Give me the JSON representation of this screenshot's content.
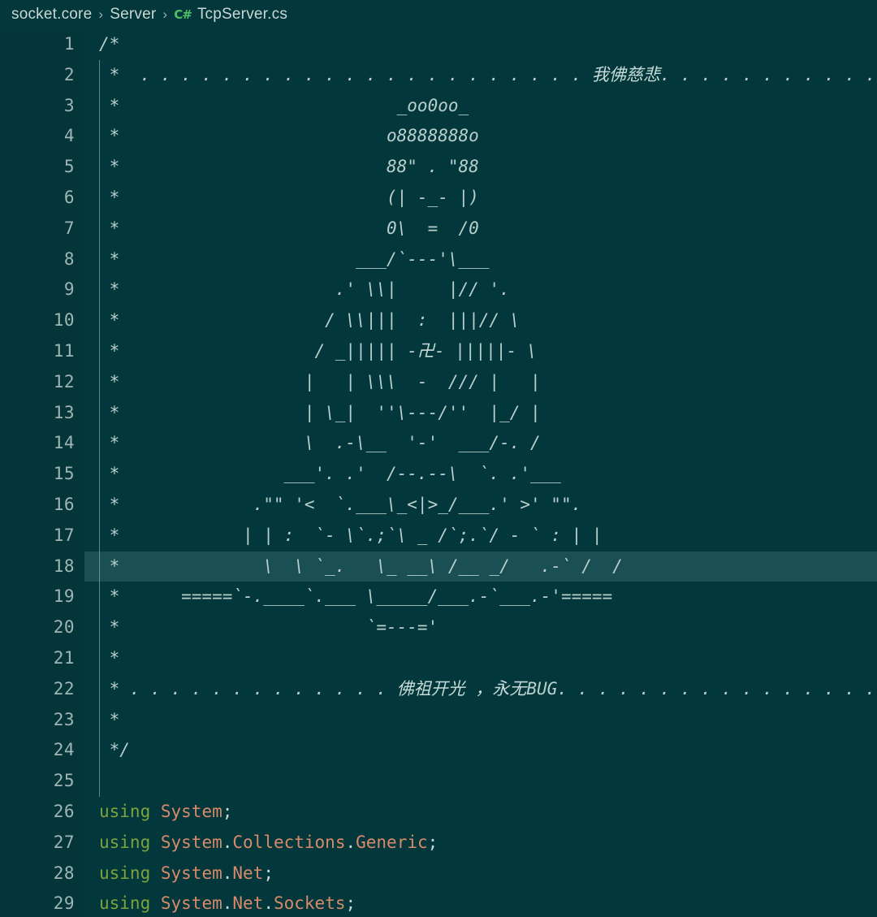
{
  "breadcrumb": {
    "name": "breadcrumb",
    "parts": [
      {
        "label": "socket.core",
        "icon": null
      },
      {
        "label": "Server",
        "icon": null
      },
      {
        "label": "TcpServer.cs",
        "icon": "csharp-icon",
        "icon_text": "C#"
      }
    ],
    "separator": "›"
  },
  "colors": {
    "background": "#02373b",
    "gutter": "#033539",
    "line_number": "#9fb6b4",
    "comment": "#b9cfcb",
    "keyword": "#7da33c",
    "namespace": "#d98a6a",
    "punctuation": "#c7d5d3",
    "csharp_icon": "#4fbf6a",
    "current_line_highlight": "rgba(150,205,205,0.17)",
    "indent_guide": "#7aa3a3"
  },
  "editor": {
    "highlighted_line": 18,
    "first_line": 1,
    "last_line": 29,
    "line_numbers": [
      1,
      2,
      3,
      4,
      5,
      6,
      7,
      8,
      9,
      10,
      11,
      12,
      13,
      14,
      15,
      16,
      17,
      18,
      19,
      20,
      21,
      22,
      23,
      24,
      25,
      26,
      27,
      28,
      29
    ],
    "lines": [
      {
        "n": 1,
        "type": "comment",
        "text": "/*"
      },
      {
        "n": 2,
        "type": "comment",
        "text": " *  . . . . . . . . . . . . . . . . . . . . . . 我佛慈悲. . . . . . . . . . . . . . . . . . . . ."
      },
      {
        "n": 3,
        "type": "comment",
        "text": " *                           _oo0oo_"
      },
      {
        "n": 4,
        "type": "comment",
        "text": " *                          o8888888o"
      },
      {
        "n": 5,
        "type": "comment",
        "text": " *                          88\" . \"88"
      },
      {
        "n": 6,
        "type": "comment",
        "text": " *                          (| -_- |)"
      },
      {
        "n": 7,
        "type": "comment",
        "text": " *                          0\\  =  /0"
      },
      {
        "n": 8,
        "type": "comment",
        "text": " *                       ___/`---'\\___"
      },
      {
        "n": 9,
        "type": "comment",
        "text": " *                     .' \\\\|     |// '."
      },
      {
        "n": 10,
        "type": "comment",
        "text": " *                    / \\\\|||  :  |||// \\"
      },
      {
        "n": 11,
        "type": "comment",
        "text": " *                   / _||||| -卍- |||||- \\"
      },
      {
        "n": 12,
        "type": "comment",
        "text": " *                  |   | \\\\\\  -  /// |   |"
      },
      {
        "n": 13,
        "type": "comment",
        "text": " *                  | \\_|  ''\\---/''  |_/ |"
      },
      {
        "n": 14,
        "type": "comment",
        "text": " *                  \\  .-\\__  '-'  ___/-. /"
      },
      {
        "n": 15,
        "type": "comment",
        "text": " *                ___'. .'  /--.--\\  `. .'___"
      },
      {
        "n": 16,
        "type": "comment",
        "text": " *             .\"\" '<  `.___\\_<|>_/___.' >' \"\"."
      },
      {
        "n": 17,
        "type": "comment",
        "text": " *            | | :  `- \\`.;`\\ _ /`;.`/ - ` : | |"
      },
      {
        "n": 18,
        "type": "comment",
        "text": " *              \\  \\ `_.   \\_ __\\ /__ _/   .-` /  /"
      },
      {
        "n": 19,
        "type": "comment",
        "text": " *      =====`-.____`.___ \\_____/___.-`___.-'====="
      },
      {
        "n": 20,
        "type": "comment",
        "text": " *                        `=---='"
      },
      {
        "n": 21,
        "type": "comment",
        "text": " *"
      },
      {
        "n": 22,
        "type": "comment",
        "text": " * . . . . . . . . . . . . . 佛祖开光 ，永无BUG. . . . . . . . . . . . . . . . ."
      },
      {
        "n": 23,
        "type": "comment",
        "text": " *"
      },
      {
        "n": 24,
        "type": "comment",
        "text": " */"
      },
      {
        "n": 25,
        "type": "blank",
        "text": ""
      },
      {
        "n": 26,
        "type": "code",
        "keyword": "using",
        "namespace": "System",
        "terminator": ";",
        "text": "using System;"
      },
      {
        "n": 27,
        "type": "code",
        "keyword": "using",
        "namespace": "System.Collections.Generic",
        "terminator": ";",
        "text": "using System.Collections.Generic;"
      },
      {
        "n": 28,
        "type": "code",
        "keyword": "using",
        "namespace": "System.Net",
        "terminator": ";",
        "text": "using System.Net;"
      },
      {
        "n": 29,
        "type": "code",
        "keyword": "using",
        "namespace": "System.Net.Sockets",
        "terminator": ";",
        "text": "using System.Net.Sockets;"
      }
    ]
  }
}
